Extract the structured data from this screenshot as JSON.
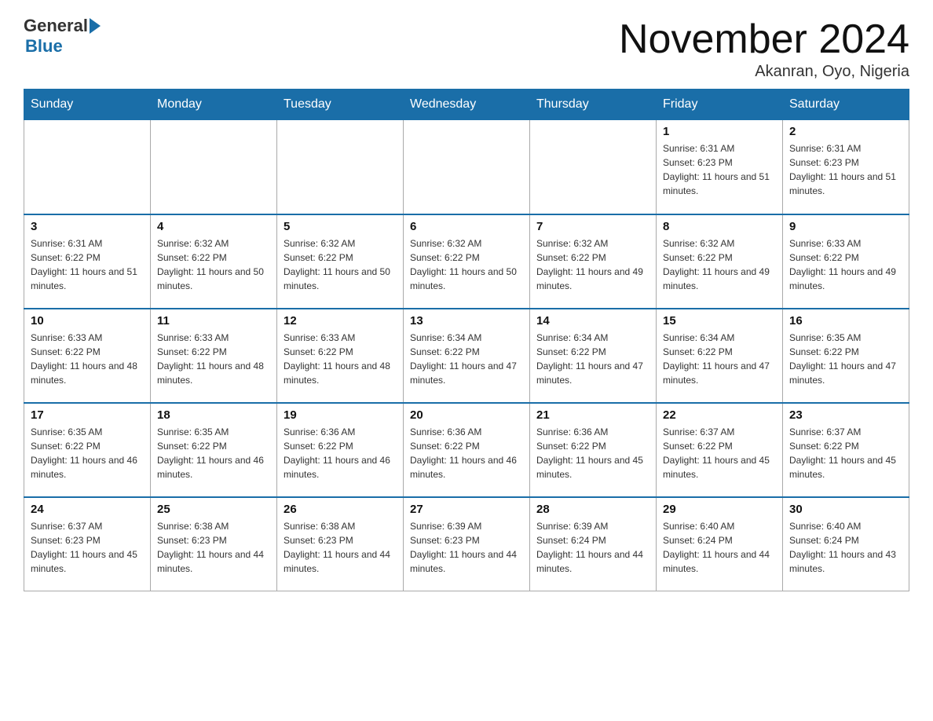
{
  "header": {
    "logo_general": "General",
    "logo_blue": "Blue",
    "month_title": "November 2024",
    "location": "Akanran, Oyo, Nigeria"
  },
  "days_of_week": [
    "Sunday",
    "Monday",
    "Tuesday",
    "Wednesday",
    "Thursday",
    "Friday",
    "Saturday"
  ],
  "weeks": [
    [
      {
        "day": "",
        "info": ""
      },
      {
        "day": "",
        "info": ""
      },
      {
        "day": "",
        "info": ""
      },
      {
        "day": "",
        "info": ""
      },
      {
        "day": "",
        "info": ""
      },
      {
        "day": "1",
        "info": "Sunrise: 6:31 AM\nSunset: 6:23 PM\nDaylight: 11 hours and 51 minutes."
      },
      {
        "day": "2",
        "info": "Sunrise: 6:31 AM\nSunset: 6:23 PM\nDaylight: 11 hours and 51 minutes."
      }
    ],
    [
      {
        "day": "3",
        "info": "Sunrise: 6:31 AM\nSunset: 6:22 PM\nDaylight: 11 hours and 51 minutes."
      },
      {
        "day": "4",
        "info": "Sunrise: 6:32 AM\nSunset: 6:22 PM\nDaylight: 11 hours and 50 minutes."
      },
      {
        "day": "5",
        "info": "Sunrise: 6:32 AM\nSunset: 6:22 PM\nDaylight: 11 hours and 50 minutes."
      },
      {
        "day": "6",
        "info": "Sunrise: 6:32 AM\nSunset: 6:22 PM\nDaylight: 11 hours and 50 minutes."
      },
      {
        "day": "7",
        "info": "Sunrise: 6:32 AM\nSunset: 6:22 PM\nDaylight: 11 hours and 49 minutes."
      },
      {
        "day": "8",
        "info": "Sunrise: 6:32 AM\nSunset: 6:22 PM\nDaylight: 11 hours and 49 minutes."
      },
      {
        "day": "9",
        "info": "Sunrise: 6:33 AM\nSunset: 6:22 PM\nDaylight: 11 hours and 49 minutes."
      }
    ],
    [
      {
        "day": "10",
        "info": "Sunrise: 6:33 AM\nSunset: 6:22 PM\nDaylight: 11 hours and 48 minutes."
      },
      {
        "day": "11",
        "info": "Sunrise: 6:33 AM\nSunset: 6:22 PM\nDaylight: 11 hours and 48 minutes."
      },
      {
        "day": "12",
        "info": "Sunrise: 6:33 AM\nSunset: 6:22 PM\nDaylight: 11 hours and 48 minutes."
      },
      {
        "day": "13",
        "info": "Sunrise: 6:34 AM\nSunset: 6:22 PM\nDaylight: 11 hours and 47 minutes."
      },
      {
        "day": "14",
        "info": "Sunrise: 6:34 AM\nSunset: 6:22 PM\nDaylight: 11 hours and 47 minutes."
      },
      {
        "day": "15",
        "info": "Sunrise: 6:34 AM\nSunset: 6:22 PM\nDaylight: 11 hours and 47 minutes."
      },
      {
        "day": "16",
        "info": "Sunrise: 6:35 AM\nSunset: 6:22 PM\nDaylight: 11 hours and 47 minutes."
      }
    ],
    [
      {
        "day": "17",
        "info": "Sunrise: 6:35 AM\nSunset: 6:22 PM\nDaylight: 11 hours and 46 minutes."
      },
      {
        "day": "18",
        "info": "Sunrise: 6:35 AM\nSunset: 6:22 PM\nDaylight: 11 hours and 46 minutes."
      },
      {
        "day": "19",
        "info": "Sunrise: 6:36 AM\nSunset: 6:22 PM\nDaylight: 11 hours and 46 minutes."
      },
      {
        "day": "20",
        "info": "Sunrise: 6:36 AM\nSunset: 6:22 PM\nDaylight: 11 hours and 46 minutes."
      },
      {
        "day": "21",
        "info": "Sunrise: 6:36 AM\nSunset: 6:22 PM\nDaylight: 11 hours and 45 minutes."
      },
      {
        "day": "22",
        "info": "Sunrise: 6:37 AM\nSunset: 6:22 PM\nDaylight: 11 hours and 45 minutes."
      },
      {
        "day": "23",
        "info": "Sunrise: 6:37 AM\nSunset: 6:22 PM\nDaylight: 11 hours and 45 minutes."
      }
    ],
    [
      {
        "day": "24",
        "info": "Sunrise: 6:37 AM\nSunset: 6:23 PM\nDaylight: 11 hours and 45 minutes."
      },
      {
        "day": "25",
        "info": "Sunrise: 6:38 AM\nSunset: 6:23 PM\nDaylight: 11 hours and 44 minutes."
      },
      {
        "day": "26",
        "info": "Sunrise: 6:38 AM\nSunset: 6:23 PM\nDaylight: 11 hours and 44 minutes."
      },
      {
        "day": "27",
        "info": "Sunrise: 6:39 AM\nSunset: 6:23 PM\nDaylight: 11 hours and 44 minutes."
      },
      {
        "day": "28",
        "info": "Sunrise: 6:39 AM\nSunset: 6:24 PM\nDaylight: 11 hours and 44 minutes."
      },
      {
        "day": "29",
        "info": "Sunrise: 6:40 AM\nSunset: 6:24 PM\nDaylight: 11 hours and 44 minutes."
      },
      {
        "day": "30",
        "info": "Sunrise: 6:40 AM\nSunset: 6:24 PM\nDaylight: 11 hours and 43 minutes."
      }
    ]
  ]
}
